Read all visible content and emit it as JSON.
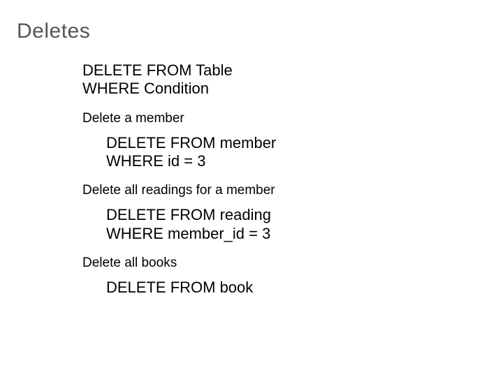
{
  "title": "Deletes",
  "syntax": {
    "line1": "DELETE FROM Table",
    "line2": "WHERE  Condition"
  },
  "sections": [
    {
      "label": "Delete a member",
      "code": {
        "line1": "DELETE FROM member",
        "line2": "WHERE  id = 3"
      }
    },
    {
      "label": "Delete all readings for a member",
      "code": {
        "line1": "DELETE FROM reading",
        "line2": "WHERE  member_id = 3"
      }
    },
    {
      "label": "Delete all books",
      "code": {
        "line1": "DELETE FROM book",
        "line2": ""
      }
    }
  ]
}
